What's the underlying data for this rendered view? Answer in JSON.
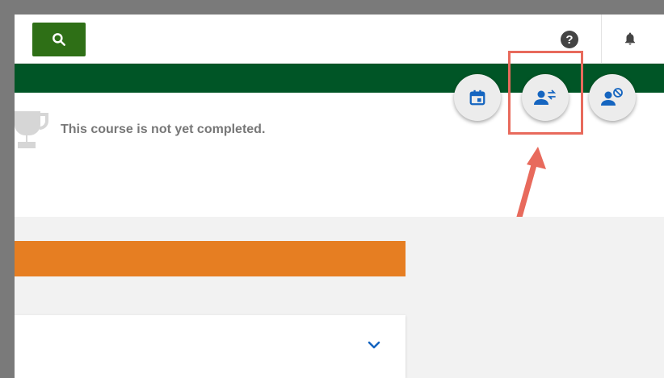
{
  "status": {
    "course_completion": "This course is not yet completed."
  },
  "icons": {
    "search": "search-icon",
    "help": "help-icon",
    "help_glyph": "?",
    "bell": "bell-icon",
    "trophy": "trophy-icon",
    "calendar": "calendar-icon",
    "transfer": "user-transfer-icon",
    "block": "user-block-icon",
    "chevron": "chevron-down-icon",
    "arrow": "arrow-annotation"
  },
  "colors": {
    "primary_green": "#2e6f16",
    "nav_green": "#005526",
    "accent_orange": "#e67e22",
    "icon_blue": "#1565c0",
    "annotation_red": "#e86a5c"
  }
}
